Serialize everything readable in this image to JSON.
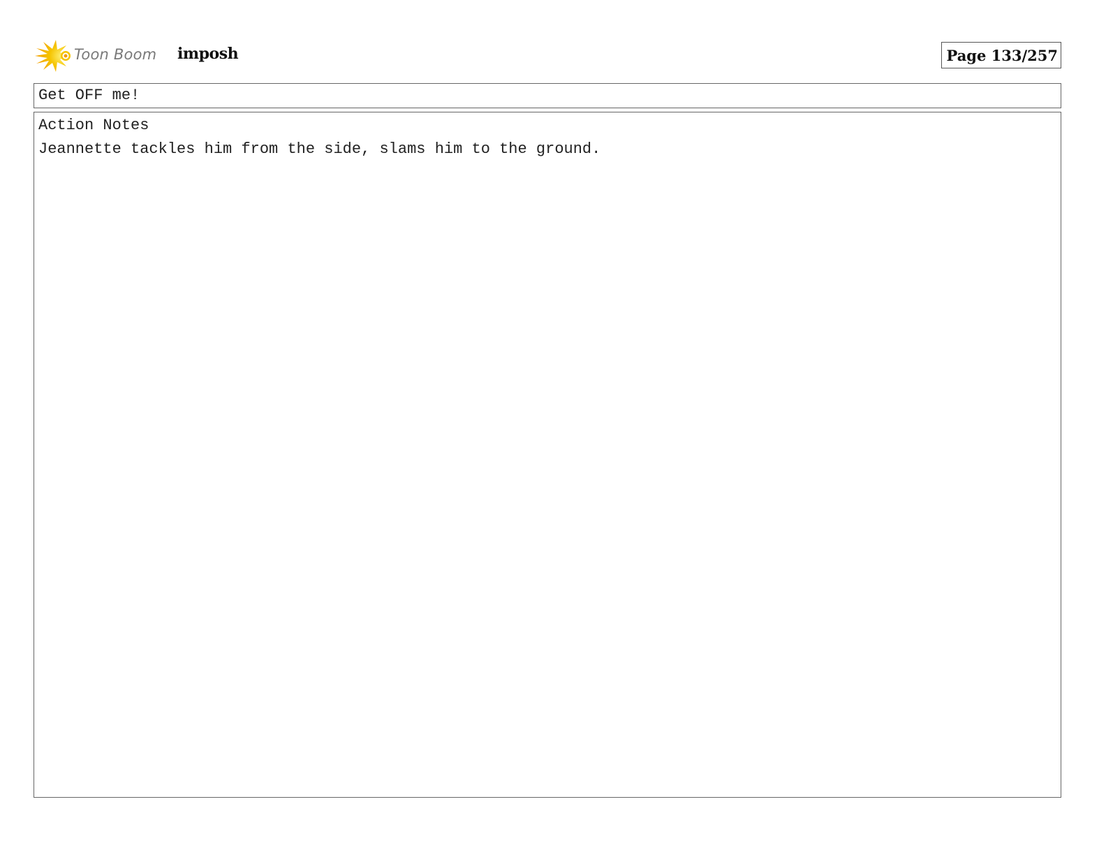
{
  "header": {
    "logo_text": "Toon Boom",
    "project_name": "imposh",
    "page_label": "Page 133/257"
  },
  "dialogue": {
    "text": "Get OFF me!"
  },
  "action_notes": {
    "heading": "Action Notes",
    "text": "Jeannette tackles him from the side, slams him to the ground."
  },
  "colors": {
    "logo_yellow": "#f5c400",
    "logo_orange": "#f39c00",
    "border": "#666666"
  },
  "icons": {
    "logo": "toon-boom-starburst-icon"
  }
}
